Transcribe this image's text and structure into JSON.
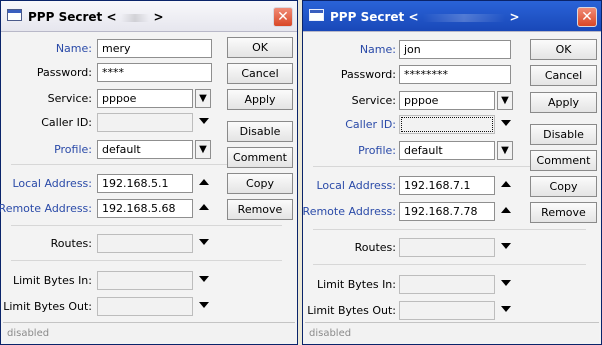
{
  "windows": [
    {
      "title": "PPP Secret",
      "title_open": "<",
      "title_close": ">",
      "close_glyph": "✕",
      "name": "mery",
      "password": "****",
      "service": "pppoe",
      "caller_id": "",
      "profile": "default",
      "local_address": "192.168.5.1",
      "remote_address": "192.168.5.68",
      "routes": "",
      "limit_bytes_in": "",
      "limit_bytes_out": "",
      "status": "disabled"
    },
    {
      "title": "PPP Secret",
      "title_open": "<",
      "title_close": ">",
      "close_glyph": "✕",
      "name": "jon",
      "password": "********",
      "service": "pppoe",
      "caller_id": "",
      "profile": "default",
      "local_address": "192.168.7.1",
      "remote_address": "192.168.7.78",
      "routes": "",
      "limit_bytes_in": "",
      "limit_bytes_out": "",
      "status": "disabled"
    }
  ],
  "labels": {
    "name": "Name:",
    "password": "Password:",
    "service": "Service:",
    "caller_id": "Caller ID:",
    "profile": "Profile:",
    "local_address": "Local Address:",
    "remote_address": "Remote Address:",
    "routes": "Routes:",
    "limit_bytes_in": "Limit Bytes In:",
    "limit_bytes_out": "Limit Bytes Out:"
  },
  "buttons": {
    "ok": "OK",
    "cancel": "Cancel",
    "apply": "Apply",
    "disable": "Disable",
    "comment": "Comment",
    "copy": "Copy",
    "remove": "Remove"
  },
  "glyphs": {
    "select_arrow": "▼"
  }
}
